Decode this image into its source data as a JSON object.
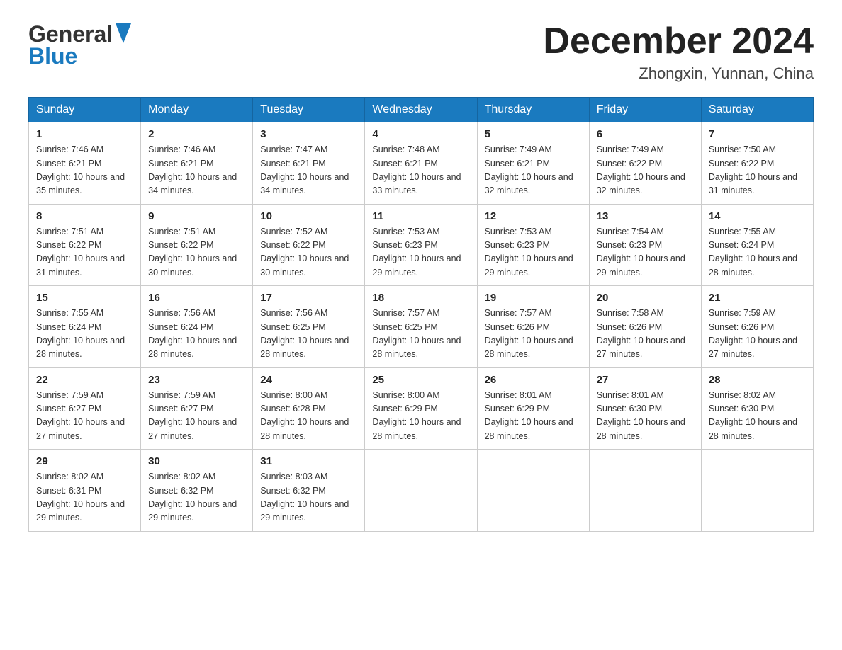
{
  "logo": {
    "general": "General",
    "blue": "Blue"
  },
  "title": "December 2024",
  "subtitle": "Zhongxin, Yunnan, China",
  "weekdays": [
    "Sunday",
    "Monday",
    "Tuesday",
    "Wednesday",
    "Thursday",
    "Friday",
    "Saturday"
  ],
  "weeks": [
    [
      {
        "day": "1",
        "sunrise": "7:46 AM",
        "sunset": "6:21 PM",
        "daylight": "10 hours and 35 minutes."
      },
      {
        "day": "2",
        "sunrise": "7:46 AM",
        "sunset": "6:21 PM",
        "daylight": "10 hours and 34 minutes."
      },
      {
        "day": "3",
        "sunrise": "7:47 AM",
        "sunset": "6:21 PM",
        "daylight": "10 hours and 34 minutes."
      },
      {
        "day": "4",
        "sunrise": "7:48 AM",
        "sunset": "6:21 PM",
        "daylight": "10 hours and 33 minutes."
      },
      {
        "day": "5",
        "sunrise": "7:49 AM",
        "sunset": "6:21 PM",
        "daylight": "10 hours and 32 minutes."
      },
      {
        "day": "6",
        "sunrise": "7:49 AM",
        "sunset": "6:22 PM",
        "daylight": "10 hours and 32 minutes."
      },
      {
        "day": "7",
        "sunrise": "7:50 AM",
        "sunset": "6:22 PM",
        "daylight": "10 hours and 31 minutes."
      }
    ],
    [
      {
        "day": "8",
        "sunrise": "7:51 AM",
        "sunset": "6:22 PM",
        "daylight": "10 hours and 31 minutes."
      },
      {
        "day": "9",
        "sunrise": "7:51 AM",
        "sunset": "6:22 PM",
        "daylight": "10 hours and 30 minutes."
      },
      {
        "day": "10",
        "sunrise": "7:52 AM",
        "sunset": "6:22 PM",
        "daylight": "10 hours and 30 minutes."
      },
      {
        "day": "11",
        "sunrise": "7:53 AM",
        "sunset": "6:23 PM",
        "daylight": "10 hours and 29 minutes."
      },
      {
        "day": "12",
        "sunrise": "7:53 AM",
        "sunset": "6:23 PM",
        "daylight": "10 hours and 29 minutes."
      },
      {
        "day": "13",
        "sunrise": "7:54 AM",
        "sunset": "6:23 PM",
        "daylight": "10 hours and 29 minutes."
      },
      {
        "day": "14",
        "sunrise": "7:55 AM",
        "sunset": "6:24 PM",
        "daylight": "10 hours and 28 minutes."
      }
    ],
    [
      {
        "day": "15",
        "sunrise": "7:55 AM",
        "sunset": "6:24 PM",
        "daylight": "10 hours and 28 minutes."
      },
      {
        "day": "16",
        "sunrise": "7:56 AM",
        "sunset": "6:24 PM",
        "daylight": "10 hours and 28 minutes."
      },
      {
        "day": "17",
        "sunrise": "7:56 AM",
        "sunset": "6:25 PM",
        "daylight": "10 hours and 28 minutes."
      },
      {
        "day": "18",
        "sunrise": "7:57 AM",
        "sunset": "6:25 PM",
        "daylight": "10 hours and 28 minutes."
      },
      {
        "day": "19",
        "sunrise": "7:57 AM",
        "sunset": "6:26 PM",
        "daylight": "10 hours and 28 minutes."
      },
      {
        "day": "20",
        "sunrise": "7:58 AM",
        "sunset": "6:26 PM",
        "daylight": "10 hours and 27 minutes."
      },
      {
        "day": "21",
        "sunrise": "7:59 AM",
        "sunset": "6:26 PM",
        "daylight": "10 hours and 27 minutes."
      }
    ],
    [
      {
        "day": "22",
        "sunrise": "7:59 AM",
        "sunset": "6:27 PM",
        "daylight": "10 hours and 27 minutes."
      },
      {
        "day": "23",
        "sunrise": "7:59 AM",
        "sunset": "6:27 PM",
        "daylight": "10 hours and 27 minutes."
      },
      {
        "day": "24",
        "sunrise": "8:00 AM",
        "sunset": "6:28 PM",
        "daylight": "10 hours and 28 minutes."
      },
      {
        "day": "25",
        "sunrise": "8:00 AM",
        "sunset": "6:29 PM",
        "daylight": "10 hours and 28 minutes."
      },
      {
        "day": "26",
        "sunrise": "8:01 AM",
        "sunset": "6:29 PM",
        "daylight": "10 hours and 28 minutes."
      },
      {
        "day": "27",
        "sunrise": "8:01 AM",
        "sunset": "6:30 PM",
        "daylight": "10 hours and 28 minutes."
      },
      {
        "day": "28",
        "sunrise": "8:02 AM",
        "sunset": "6:30 PM",
        "daylight": "10 hours and 28 minutes."
      }
    ],
    [
      {
        "day": "29",
        "sunrise": "8:02 AM",
        "sunset": "6:31 PM",
        "daylight": "10 hours and 29 minutes."
      },
      {
        "day": "30",
        "sunrise": "8:02 AM",
        "sunset": "6:32 PM",
        "daylight": "10 hours and 29 minutes."
      },
      {
        "day": "31",
        "sunrise": "8:03 AM",
        "sunset": "6:32 PM",
        "daylight": "10 hours and 29 minutes."
      },
      null,
      null,
      null,
      null
    ]
  ]
}
